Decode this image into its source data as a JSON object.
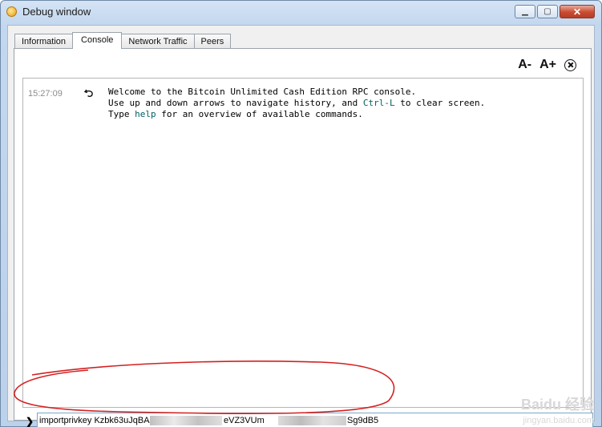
{
  "window": {
    "title": "Debug window"
  },
  "tabs": [
    {
      "label": "Information"
    },
    {
      "label": "Console",
      "active": true
    },
    {
      "label": "Network Traffic"
    },
    {
      "label": "Peers"
    }
  ],
  "font_controls": {
    "decrease_label": "A-",
    "increase_label": "A+",
    "clear_icon": "close-circle-icon"
  },
  "console": {
    "messages": [
      {
        "time": "15:27:09",
        "icon": "reply-arrow-icon",
        "line1": "Welcome to the Bitcoin Unlimited Cash Edition RPC console.",
        "line2_pre": "Use up and down arrows to navigate history, and ",
        "line2_cmd": "Ctrl-L",
        "line2_post": " to clear screen.",
        "line3_pre": "Type ",
        "line3_cmd": "help",
        "line3_post": " for an overview of available commands."
      }
    ]
  },
  "command_input": {
    "prompt_icon": "chevron-right-icon",
    "value_part1": "importprivkey Kzbk63uJqBA",
    "value_part2": "eVZ3VUm",
    "value_part3": "Sg9dB5"
  },
  "annotation": {
    "color": "#d42020"
  },
  "watermark": {
    "text": "Baidu 经验",
    "sub": "jingyan.baidu.com"
  }
}
